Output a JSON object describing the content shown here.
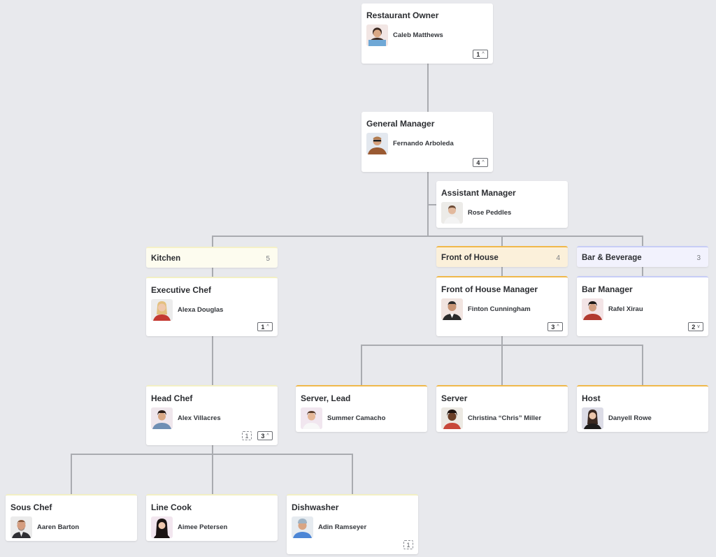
{
  "colors": {
    "background": "#e8e9ed",
    "connector": "#a9abb0",
    "kitchen_accent": "#f5f1c8",
    "front_of_house_accent": "#f0b84a",
    "bar_accent": "#c7cdf6"
  },
  "nodes": {
    "owner": {
      "title": "Restaurant Owner",
      "name": "Caleb Matthews",
      "reports": "1",
      "toggle_icon": "chevron-up"
    },
    "gm": {
      "title": "General Manager",
      "name": "Fernando Arboleda",
      "reports": "4",
      "toggle_icon": "chevron-up"
    },
    "asst": {
      "title": "Assistant Manager",
      "name": "Rose Peddles"
    },
    "exec_chef": {
      "title": "Executive Chef",
      "name": "Alexa Douglas",
      "reports": "1",
      "toggle_icon": "chevron-up"
    },
    "foh_mgr": {
      "title": "Front of House Manager",
      "name": "Finton Cunningham",
      "reports": "3",
      "toggle_icon": "chevron-up"
    },
    "bar_mgr": {
      "title": "Bar Manager",
      "name": "Rafel Xirau",
      "reports": "2",
      "toggle_icon": "chevron-down"
    },
    "head_chef": {
      "title": "Head Chef",
      "name": "Alex Villacres",
      "assistants": "1",
      "reports": "3",
      "toggle_icon": "chevron-up"
    },
    "server_lead": {
      "title": "Server, Lead",
      "name": "Summer Camacho"
    },
    "server": {
      "title": "Server",
      "name": "Christina “Chris” Miller"
    },
    "host": {
      "title": "Host",
      "name": "Danyell Rowe"
    },
    "sous_chef": {
      "title": "Sous Chef",
      "name": "Aaren Barton"
    },
    "line_cook": {
      "title": "Line Cook",
      "name": "Aimee Petersen"
    },
    "dishwasher": {
      "title": "Dishwasher",
      "name": "Adin Ramseyer",
      "assistants": "1"
    }
  },
  "departments": {
    "kitchen": {
      "label": "Kitchen",
      "count": "5"
    },
    "foh": {
      "label": "Front of House",
      "count": "4"
    },
    "bar": {
      "label": "Bar & Beverage",
      "count": "3"
    }
  },
  "chevrons": {
    "up": "^",
    "down": "v"
  }
}
